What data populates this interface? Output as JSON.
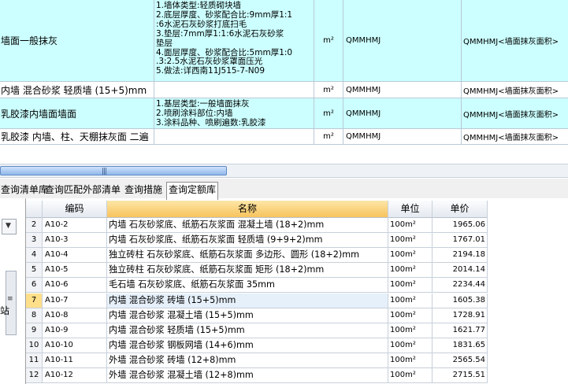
{
  "top_grid": {
    "rows": [
      {
        "name": "墙面一般抹灰",
        "features": [
          "1.墙体类型:轻质砌块墙",
          "2.底层厚度、砂浆配合比:9mm厚1:1",
          ":6水泥石灰砂浆打底扫毛",
          "3.垫层:7mm厚1:1:6水泥石灰砂浆",
          "垫层",
          "4.面层厚度、砂浆配合比:5mm厚1:0",
          ".3:2.5水泥石灰砂浆罩面压光",
          "5.做法:详西南11J515-7-N09"
        ],
        "unit": "m²",
        "code": "QMMHMJ",
        "expr": "QMMHMJ<墙面抹灰面积>"
      },
      {
        "name": "内墙 混合砂浆 轻质墙 (15+5)mm",
        "features": [],
        "unit": "m²",
        "code": "QMMHMJ",
        "expr": "QMMHMJ<墙面抹灰面积>"
      },
      {
        "name": "乳胶漆内墙面墙面",
        "features": [
          "1.基层类型:一般墙面抹灰",
          "2.喷刷涂料部位:内墙",
          "3.涂料品种、喷刷遍数:乳胶漆"
        ],
        "unit": "m²",
        "code": "QMMHMJ",
        "expr": "QMMHMJ<墙面抹灰面积>"
      },
      {
        "name": "乳胶漆 内墙、柱、天棚抹灰面 二遍",
        "features": [],
        "unit": "m²",
        "code": "QMMHMJ",
        "expr": "QMMHMJ<墙面抹灰面积>"
      }
    ]
  },
  "scrollbar": {
    "grip": "|||"
  },
  "tabs": [
    {
      "label": "查询清单库"
    },
    {
      "label": "查询匹配外部清单"
    },
    {
      "label": "查询措施"
    },
    {
      "label": "查询定额库",
      "active": true
    }
  ],
  "left_panel": {
    "fragment": "站"
  },
  "quota_table": {
    "headers": {
      "code": "编码",
      "name": "名称",
      "unit": "单位",
      "price": "单价"
    },
    "rows": [
      {
        "idx": "2",
        "code": "A10-2",
        "name": "内墙 石灰砂浆底、纸筋石灰浆面 混凝土墙 (18+2)mm",
        "unit": "100m²",
        "price": "1965.06"
      },
      {
        "idx": "3",
        "code": "A10-3",
        "name": "内墙 石灰砂浆底、纸筋石灰浆面 轻质墙 (9+9+2)mm",
        "unit": "100m²",
        "price": "1767.01"
      },
      {
        "idx": "4",
        "code": "A10-4",
        "name": "独立砖柱 石灰砂浆底、纸筋石灰浆面 多边形、圆形 (18+2)mm",
        "unit": "100m²",
        "price": "2194.18"
      },
      {
        "idx": "5",
        "code": "A10-5",
        "name": "独立砖柱 石灰砂浆底、纸筋石灰浆面 矩形 (18+2)mm",
        "unit": "100m²",
        "price": "2014.14"
      },
      {
        "idx": "6",
        "code": "A10-6",
        "name": "毛石墙 石灰砂浆底、纸筋石灰浆面 35mm",
        "unit": "100m²",
        "price": "2234.44"
      },
      {
        "idx": "7",
        "code": "A10-7",
        "name": "内墙 混合砂浆 砖墙 (15+5)mm",
        "unit": "100m²",
        "price": "1605.38",
        "selected": true
      },
      {
        "idx": "8",
        "code": "A10-8",
        "name": "内墙 混合砂浆 混凝土墙 (15+5)mm",
        "unit": "100m²",
        "price": "1728.91"
      },
      {
        "idx": "9",
        "code": "A10-9",
        "name": "内墙 混合砂浆 轻质墙 (15+5)mm",
        "unit": "100m²",
        "price": "1621.77"
      },
      {
        "idx": "10",
        "code": "A10-10",
        "name": "内墙 混合砂浆 钢板网墙 (14+6)mm",
        "unit": "100m²",
        "price": "1831.65"
      },
      {
        "idx": "11",
        "code": "A10-11",
        "name": "外墙 混合砂浆 砖墙 (12+8)mm",
        "unit": "100m²",
        "price": "2565.54"
      },
      {
        "idx": "12",
        "code": "A10-12",
        "name": "外墙 混合砂浆 混凝土墙 (12+8)mm",
        "unit": "100m²",
        "price": "2715.51"
      }
    ]
  },
  "colors": {
    "selected_row": "#ccffff",
    "sorted_header": "#f7c35c",
    "row_index_selected": "#ffdf8a"
  }
}
